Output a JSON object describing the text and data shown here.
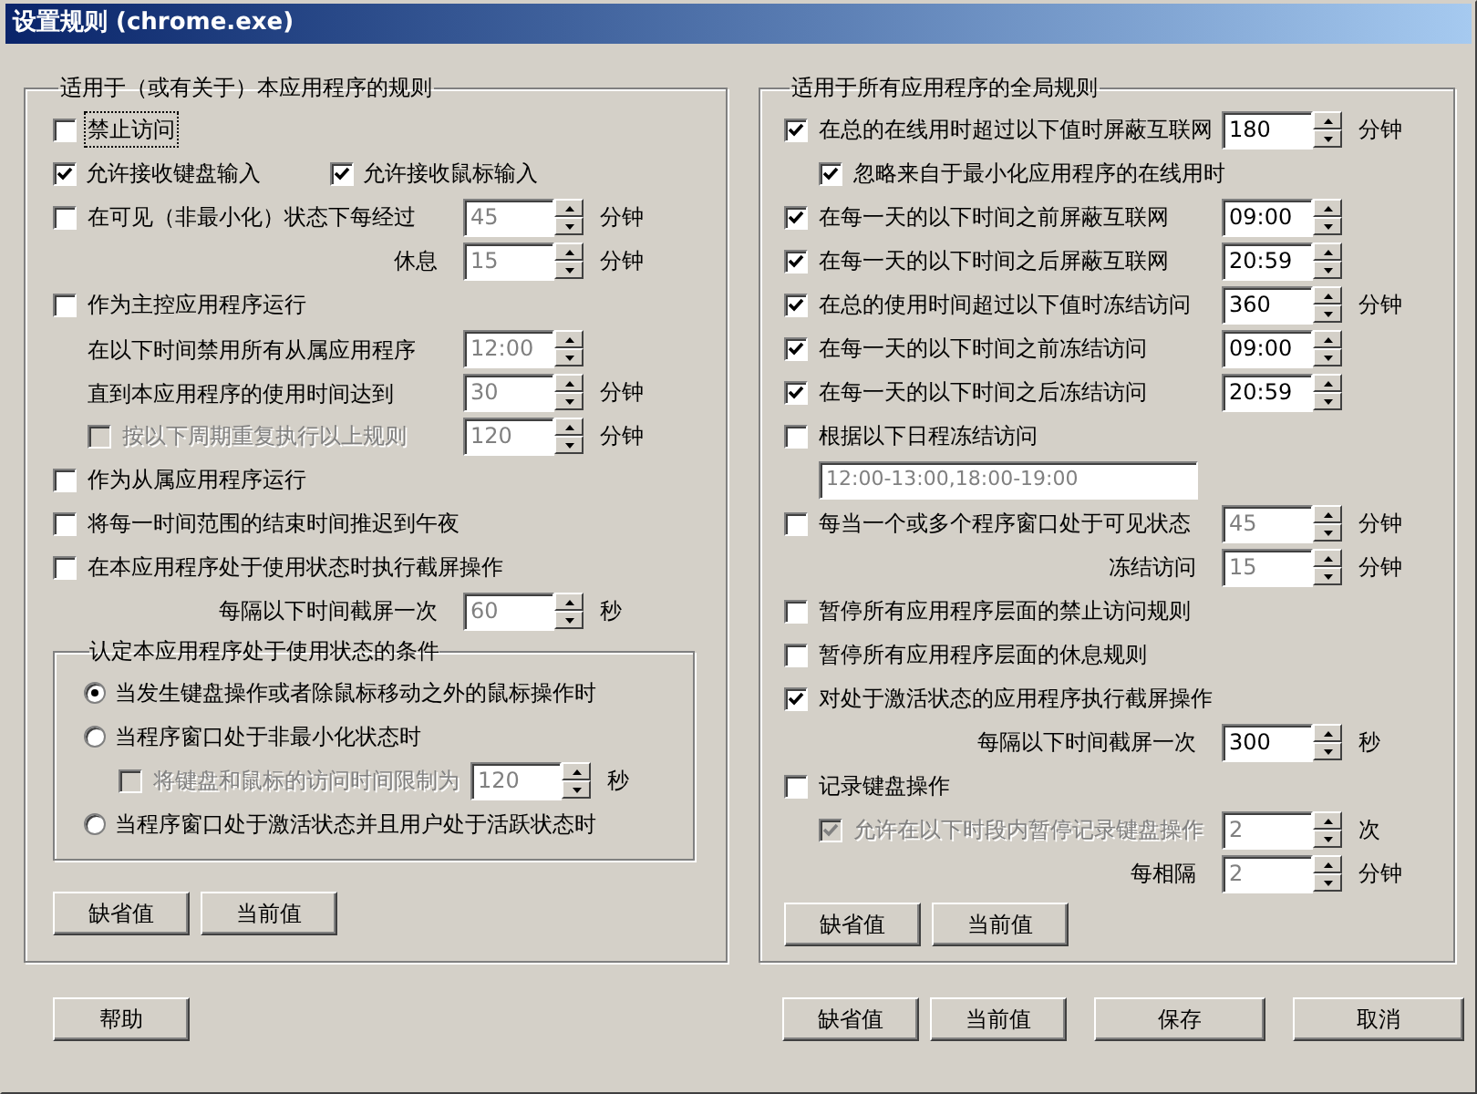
{
  "window": {
    "title": "设置规则 (chrome.exe)"
  },
  "app_rules": {
    "title": "适用于（或有关于）本应用程序的规则",
    "rows": [
      {
        "kind": "check",
        "label": "禁止访问",
        "checked": false,
        "disabled": false,
        "focused": true
      },
      {
        "kind": "pair",
        "items": [
          {
            "label": "允许接收键盘输入",
            "checked": true
          },
          {
            "label": "允许接收鼠标输入",
            "checked": true
          }
        ]
      },
      {
        "kind": "check",
        "label": "在可见（非最小化）状态下每经过",
        "checked": false,
        "disabled": false,
        "spin": {
          "value": "45",
          "disabled": true
        },
        "unit": "分钟"
      },
      {
        "kind": "label",
        "label": "休息",
        "spin": {
          "value": "15",
          "disabled": true
        },
        "unit": "分钟"
      },
      {
        "kind": "check",
        "label": "作为主控应用程序运行",
        "checked": false,
        "disabled": false
      },
      {
        "kind": "text",
        "label": "在以下时间禁用所有从属应用程序",
        "spin": {
          "value": "12:00",
          "disabled": true
        }
      },
      {
        "kind": "text",
        "label": "直到本应用程序的使用时间达到",
        "spin": {
          "value": "30",
          "disabled": true
        },
        "unit": "分钟"
      },
      {
        "kind": "subcheck",
        "label": "按以下周期重复执行以上规则",
        "checked": false,
        "disabled": true,
        "spin": {
          "value": "120",
          "disabled": true
        },
        "unit": "分钟"
      },
      {
        "kind": "check",
        "label": "作为从属应用程序运行",
        "checked": false,
        "disabled": false
      },
      {
        "kind": "check",
        "label": "将每一时间范围的结束时间推迟到午夜",
        "checked": false,
        "disabled": false
      },
      {
        "kind": "check",
        "label": "在本应用程序处于使用状态时执行截屏操作",
        "checked": false,
        "disabled": false
      },
      {
        "kind": "label",
        "label": "每隔以下时间截屏一次",
        "spin": {
          "value": "60",
          "disabled": true
        },
        "unit": "秒"
      }
    ],
    "usage_conditions": {
      "title": "认定本应用程序处于使用状态的条件",
      "options": [
        {
          "kind": "radio",
          "label": "当发生键盘操作或者除鼠标移动之外的鼠标操作时",
          "selected": true
        },
        {
          "kind": "radio",
          "label": "当程序窗口处于非最小化状态时",
          "selected": false
        },
        {
          "kind": "subcheck",
          "label": "将键盘和鼠标的访问时间限制为",
          "checked": false,
          "disabled": true,
          "spin": {
            "value": "120",
            "disabled": true
          },
          "unit": "秒"
        },
        {
          "kind": "radio",
          "label": "当程序窗口处于激活状态并且用户处于活跃状态时",
          "selected": false
        }
      ]
    },
    "buttons": [
      "缺省值",
      "当前值"
    ]
  },
  "global_rules": {
    "title": "适用于所有应用程序的全局规则",
    "rows": [
      {
        "kind": "check",
        "label": "在总的在线用时超过以下值时屏蔽互联网",
        "checked": true,
        "disabled": false,
        "spin": {
          "value": "180",
          "disabled": false
        },
        "unit": "分钟"
      },
      {
        "kind": "subcheck",
        "label": "忽略来自于最小化应用程序的在线用时",
        "checked": true,
        "disabled": false
      },
      {
        "kind": "check",
        "label": "在每一天的以下时间之前屏蔽互联网",
        "checked": true,
        "disabled": false,
        "spin": {
          "value": "09:00",
          "disabled": false
        }
      },
      {
        "kind": "check",
        "label": "在每一天的以下时间之后屏蔽互联网",
        "checked": true,
        "disabled": false,
        "spin": {
          "value": "20:59",
          "disabled": false
        }
      },
      {
        "kind": "check",
        "label": "在总的使用时间超过以下值时冻结访问",
        "checked": true,
        "disabled": false,
        "spin": {
          "value": "360",
          "disabled": false
        },
        "unit": "分钟"
      },
      {
        "kind": "check",
        "label": "在每一天的以下时间之前冻结访问",
        "checked": true,
        "disabled": false,
        "spin": {
          "value": "09:00",
          "disabled": false
        }
      },
      {
        "kind": "check",
        "label": "在每一天的以下时间之后冻结访问",
        "checked": true,
        "disabled": false,
        "spin": {
          "value": "20:59",
          "disabled": false
        }
      },
      {
        "kind": "check",
        "label": "根据以下日程冻结访问",
        "checked": false,
        "disabled": false
      },
      {
        "kind": "field",
        "value": "12:00-13:00,18:00-19:00",
        "disabled": true
      },
      {
        "kind": "check",
        "label": "每当一个或多个程序窗口处于可见状态",
        "checked": false,
        "disabled": false,
        "spin": {
          "value": "45",
          "disabled": true
        },
        "unit": "分钟"
      },
      {
        "kind": "label",
        "label": "冻结访问",
        "spin": {
          "value": "15",
          "disabled": true
        },
        "unit": "分钟"
      },
      {
        "kind": "check",
        "label": "暂停所有应用程序层面的禁止访问规则",
        "checked": false,
        "disabled": false
      },
      {
        "kind": "check",
        "label": "暂停所有应用程序层面的休息规则",
        "checked": false,
        "disabled": false
      },
      {
        "kind": "check",
        "label": "对处于激活状态的应用程序执行截屏操作",
        "checked": true,
        "disabled": false
      },
      {
        "kind": "label",
        "label": "每隔以下时间截屏一次",
        "spin": {
          "value": "300",
          "disabled": false
        },
        "unit": "秒"
      },
      {
        "kind": "check",
        "label": "记录键盘操作",
        "checked": false,
        "disabled": false
      },
      {
        "kind": "subcheck",
        "label": "允许在以下时段内暂停记录键盘操作",
        "checked": true,
        "disabled": true,
        "spin": {
          "value": "2",
          "disabled": true
        },
        "unit": "次"
      },
      {
        "kind": "label",
        "label": "每相隔",
        "spin": {
          "value": "2",
          "disabled": true
        },
        "unit": "分钟"
      }
    ],
    "buttons": [
      "缺省值",
      "当前值"
    ]
  },
  "footer": {
    "left_buttons": [
      "帮助"
    ],
    "right_buttons": [
      "缺省值",
      "当前值",
      "保存",
      "取消"
    ]
  }
}
